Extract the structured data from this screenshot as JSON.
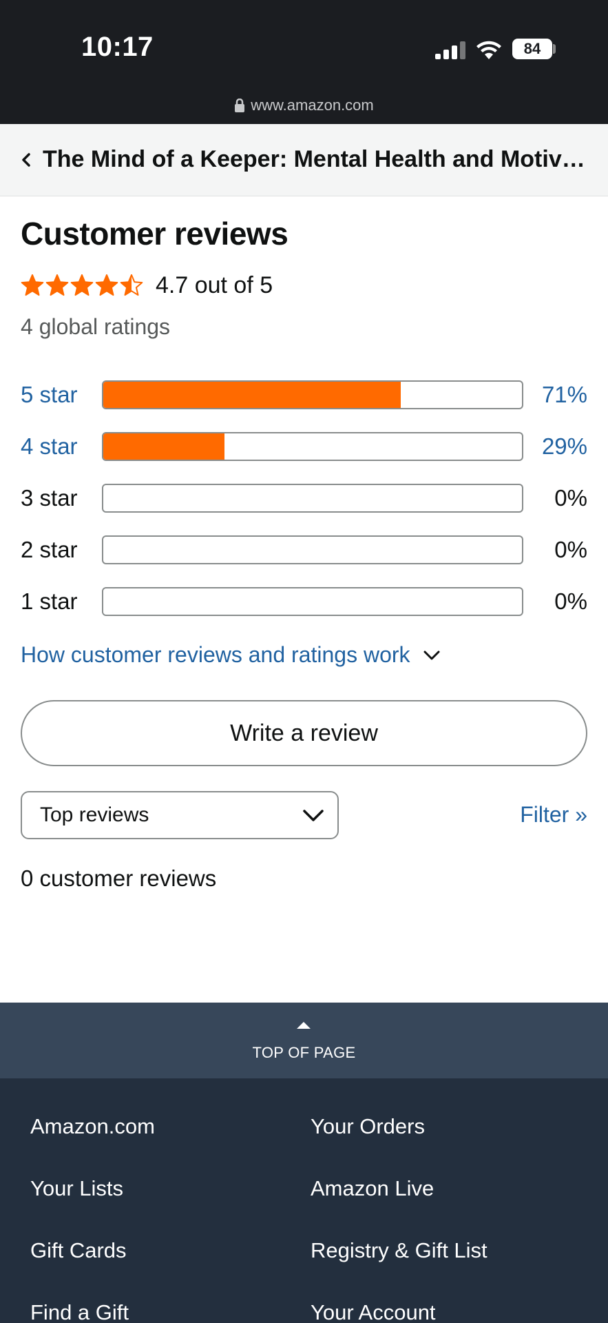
{
  "status_bar": {
    "time": "10:17",
    "battery": "84",
    "url": "www.amazon.com"
  },
  "header": {
    "title": "The Mind of a Keeper: Mental Health and Motivation"
  },
  "reviews": {
    "heading": "Customer reviews",
    "average_text": "4.7 out of 5",
    "average_stars": 4.5,
    "global_ratings": "4 global ratings",
    "histogram": [
      {
        "label": "5 star",
        "percent_label": "71%",
        "fraction": 0.71,
        "linked": true
      },
      {
        "label": "4 star",
        "percent_label": "29%",
        "fraction": 0.29,
        "linked": true
      },
      {
        "label": "3 star",
        "percent_label": "0%",
        "fraction": 0,
        "linked": false
      },
      {
        "label": "2 star",
        "percent_label": "0%",
        "fraction": 0,
        "linked": false
      },
      {
        "label": "1 star",
        "percent_label": "0%",
        "fraction": 0,
        "linked": false
      }
    ],
    "how_link": "How customer reviews and ratings work",
    "write_button": "Write a review",
    "sort_selected": "Top reviews",
    "filter_link": "Filter »",
    "count_text": "0 customer reviews"
  },
  "footer": {
    "top_of_page": "TOP OF PAGE",
    "links_left": [
      "Amazon.com",
      "Your Lists",
      "Gift Cards",
      "Find a Gift"
    ],
    "links_right": [
      "Your Orders",
      "Amazon Live",
      "Registry & Gift List",
      "Your Account"
    ]
  },
  "colors": {
    "star_fill": "#ff6a00",
    "link": "#2162a1",
    "footer_bg": "#232f3e",
    "top_of_page_bg": "#37475a"
  }
}
